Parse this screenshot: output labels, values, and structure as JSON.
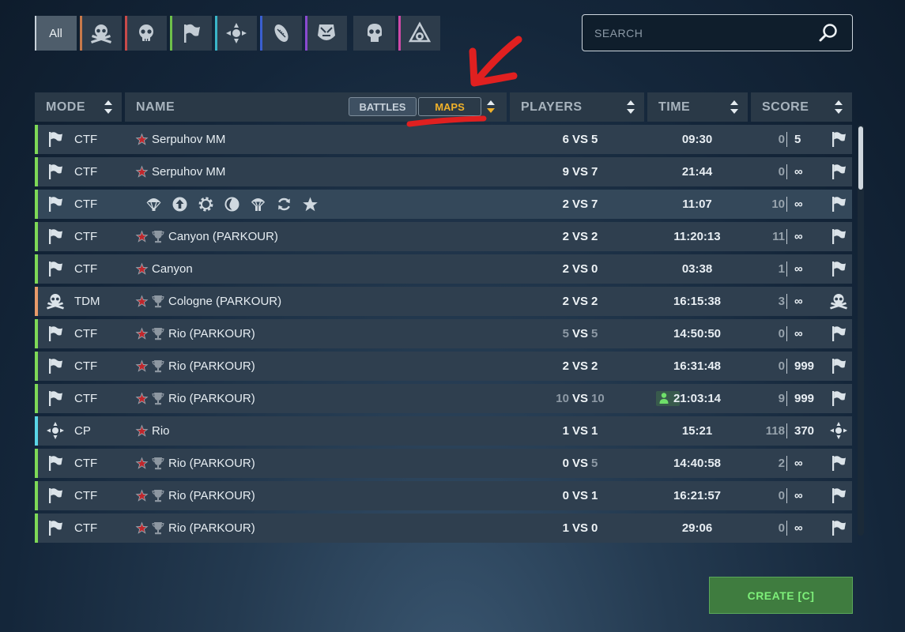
{
  "filters": {
    "all_label": "All",
    "tabs": [
      {
        "icon": "skull-and-bones-icon",
        "color": "#c8794a"
      },
      {
        "icon": "skull-icon",
        "color": "#c84a4a"
      },
      {
        "icon": "flag-icon",
        "color": "#6ec04a"
      },
      {
        "icon": "crosshair-icon",
        "color": "#3ab5c8"
      },
      {
        "icon": "rugby-ball-icon",
        "color": "#3a5fd0"
      },
      {
        "icon": "mask-icon",
        "color": "#8a4ad0"
      },
      {
        "icon": "skull-icon",
        "color": ""
      },
      {
        "icon": "triangle-bomb-icon",
        "color": "#d04aa8"
      }
    ]
  },
  "search": {
    "placeholder": "SEARCH"
  },
  "header": {
    "mode": "MODE",
    "name": "NAME",
    "battles": "BATTLES",
    "maps": "MAPS",
    "players": "PLAYERS",
    "time": "TIME",
    "score": "SCORE"
  },
  "rows": [
    {
      "mode": "CTF",
      "icon": "flag",
      "star": true,
      "trophy": false,
      "name": "Serpuhov MM",
      "p1": "6",
      "vs": "VS",
      "p2": "5",
      "p1dim": false,
      "p2dim": false,
      "time": "09:30",
      "sl": "0",
      "sr": "5",
      "bar": "#7ed957"
    },
    {
      "mode": "CTF",
      "icon": "flag",
      "star": true,
      "trophy": false,
      "name": "Serpuhov MM",
      "p1": "9",
      "vs": "VS",
      "p2": "7",
      "p1dim": false,
      "p2dim": false,
      "time": "21:44",
      "sl": "0",
      "sr": "∞",
      "bar": "#7ed957"
    },
    {
      "mode": "CTF",
      "icon": "flag",
      "star": false,
      "trophy": false,
      "name": "",
      "bonus": true,
      "p1": "2",
      "vs": "VS",
      "p2": "7",
      "p1dim": false,
      "p2dim": false,
      "time": "11:07",
      "sl": "10",
      "sr": "∞",
      "bar": "#7ed957"
    },
    {
      "mode": "CTF",
      "icon": "flag",
      "star": true,
      "trophy": true,
      "name": "Canyon (PARKOUR)",
      "p1": "2",
      "vs": "VS",
      "p2": "2",
      "p1dim": false,
      "p2dim": false,
      "time": "11:20:13",
      "sl": "11",
      "sr": "∞",
      "bar": "#7ed957"
    },
    {
      "mode": "CTF",
      "icon": "flag",
      "star": true,
      "trophy": false,
      "name": "Canyon",
      "p1": "2",
      "vs": "VS",
      "p2": "0",
      "p1dim": false,
      "p2dim": false,
      "time": "03:38",
      "sl": "1",
      "sr": "∞",
      "bar": "#7ed957"
    },
    {
      "mode": "TDM",
      "icon": "skullbones",
      "star": true,
      "trophy": true,
      "name": "Cologne (PARKOUR)",
      "p1": "2",
      "vs": "VS",
      "p2": "2",
      "p1dim": false,
      "p2dim": false,
      "time": "16:15:38",
      "sl": "3",
      "sr": "∞",
      "bar": "#e89a6a"
    },
    {
      "mode": "CTF",
      "icon": "flag",
      "star": true,
      "trophy": true,
      "name": "Rio (PARKOUR)",
      "p1": "5",
      "vs": "VS",
      "p2": "5",
      "p1dim": true,
      "p2dim": true,
      "time": "14:50:50",
      "sl": "0",
      "sr": "∞",
      "bar": "#7ed957"
    },
    {
      "mode": "CTF",
      "icon": "flag",
      "star": true,
      "trophy": true,
      "name": "Rio (PARKOUR)",
      "p1": "2",
      "vs": "VS",
      "p2": "2",
      "p1dim": false,
      "p2dim": false,
      "time": "16:31:48",
      "sl": "0",
      "sr": "999",
      "bar": "#7ed957"
    },
    {
      "mode": "CTF",
      "icon": "flag",
      "star": true,
      "trophy": true,
      "name": "Rio (PARKOUR)",
      "p1": "10",
      "vs": "VS",
      "p2": "10",
      "p1dim": true,
      "p2dim": true,
      "time": "21:03:14",
      "sl": "9",
      "sr": "999",
      "bar": "#7ed957",
      "badge": true
    },
    {
      "mode": "CP",
      "icon": "cp",
      "star": true,
      "trophy": false,
      "name": "Rio",
      "p1": "1",
      "vs": "VS",
      "p2": "1",
      "p1dim": false,
      "p2dim": false,
      "time": "15:21",
      "sl": "118",
      "sr": "370",
      "bar": "#5ad6e8"
    },
    {
      "mode": "CTF",
      "icon": "flag",
      "star": true,
      "trophy": true,
      "name": "Rio (PARKOUR)",
      "p1": "0",
      "vs": "VS",
      "p2": "5",
      "p1dim": false,
      "p2dim": true,
      "time": "14:40:58",
      "sl": "2",
      "sr": "∞",
      "bar": "#7ed957"
    },
    {
      "mode": "CTF",
      "icon": "flag",
      "star": true,
      "trophy": true,
      "name": "Rio (PARKOUR)",
      "p1": "0",
      "vs": "VS",
      "p2": "1",
      "p1dim": false,
      "p2dim": false,
      "time": "16:21:57",
      "sl": "0",
      "sr": "∞",
      "bar": "#7ed957"
    },
    {
      "mode": "CTF",
      "icon": "flag",
      "star": true,
      "trophy": true,
      "name": "Rio (PARKOUR)",
      "p1": "1",
      "vs": "VS",
      "p2": "0",
      "p1dim": false,
      "p2dim": false,
      "time": "29:06",
      "sl": "0",
      "sr": "∞",
      "bar": "#7ed957"
    }
  ],
  "create_label": "CREATE [C]"
}
